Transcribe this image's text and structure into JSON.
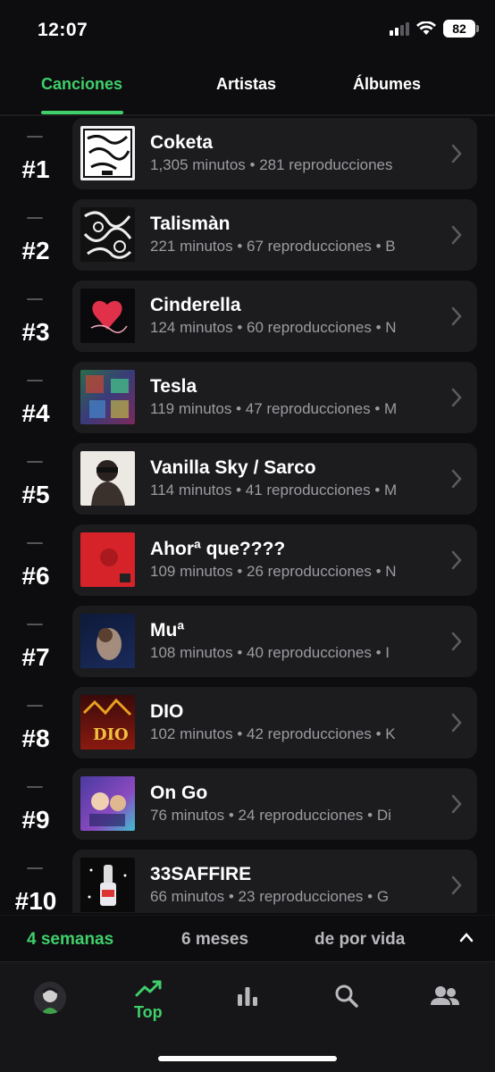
{
  "status": {
    "time": "12:07",
    "battery": "82"
  },
  "tabs": [
    {
      "label": "Canciones",
      "active": true
    },
    {
      "label": "Artistas",
      "active": false
    },
    {
      "label": "Álbumes",
      "active": false
    }
  ],
  "songs": [
    {
      "rank": "#1",
      "title": "Coketa",
      "subtitle": "1,305 minutos • 281 reproducciones"
    },
    {
      "rank": "#2",
      "title": "Talismàn",
      "subtitle": "221 minutos • 67 reproducciones • B"
    },
    {
      "rank": "#3",
      "title": "Cinderella",
      "subtitle": "124 minutos • 60 reproducciones • N"
    },
    {
      "rank": "#4",
      "title": "Tesla",
      "subtitle": "119 minutos • 47 reproducciones • M"
    },
    {
      "rank": "#5",
      "title": "Vanilla Sky / Sarco",
      "subtitle": "114 minutos • 41 reproducciones • M"
    },
    {
      "rank": "#6",
      "title": "Ahorª que????",
      "subtitle": "109 minutos • 26 reproducciones • N"
    },
    {
      "rank": "#7",
      "title": "Muª",
      "subtitle": "108 minutos • 40 reproducciones • I"
    },
    {
      "rank": "#8",
      "title": "DIO",
      "subtitle": "102 minutos • 42 reproducciones • K"
    },
    {
      "rank": "#9",
      "title": "On Go",
      "subtitle": "76 minutos • 24 reproducciones • Di"
    },
    {
      "rank": "#10",
      "title": "33SAFFIRE",
      "subtitle": "66 minutos • 23 reproducciones • G"
    }
  ],
  "range": [
    {
      "label": "4 semanas",
      "active": true
    },
    {
      "label": "6 meses",
      "active": false
    },
    {
      "label": "de por vida",
      "active": false
    }
  ],
  "nav": {
    "top_label": "Top"
  },
  "colors": {
    "accent": "#3fcf6b",
    "card": "#1c1c1f",
    "background": "#0d0d0f"
  }
}
